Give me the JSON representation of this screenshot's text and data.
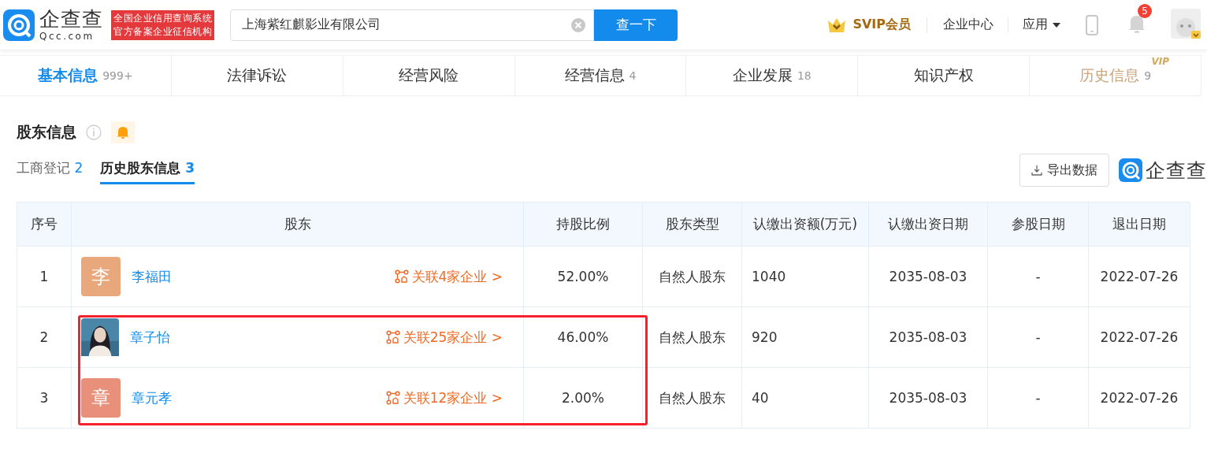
{
  "header": {
    "brand": "企查查",
    "domain": "Qcc.com",
    "badge_lines": [
      "全国企业信用查询系统",
      "官方备案企业征信机构"
    ],
    "search": {
      "value": "上海紫红麒影业有限公司"
    },
    "search_button": "查一下",
    "svip": "SVIP会员",
    "nav": [
      {
        "label": "企业中心",
        "kind": "link"
      },
      {
        "label": "应用",
        "kind": "dropdown"
      }
    ],
    "notification_count": "5"
  },
  "tabs": [
    {
      "label": "基本信息",
      "count": "999+",
      "selected": true,
      "kind": "normal"
    },
    {
      "label": "法律诉讼",
      "selected": false,
      "kind": "normal"
    },
    {
      "label": "经营风险",
      "selected": false,
      "kind": "normal"
    },
    {
      "label": "经营信息",
      "count": "4",
      "selected": false,
      "kind": "normal"
    },
    {
      "label": "企业发展",
      "count": "18",
      "selected": false,
      "kind": "normal"
    },
    {
      "label": "知识产权",
      "selected": false,
      "kind": "normal"
    },
    {
      "label": "历史信息",
      "count": "9",
      "selected": false,
      "kind": "vip",
      "badge": "VIP"
    }
  ],
  "section": {
    "title": "股东信息",
    "subtabs": [
      {
        "label": "工商登记",
        "count": "2",
        "selected": false
      },
      {
        "label": "历史股东信息",
        "count": "3",
        "selected": true
      }
    ],
    "export_button": "导出数据",
    "watermark_brand": "企查查"
  },
  "table": {
    "columns": [
      "序号",
      "股东",
      "持股比例",
      "股东类型",
      "认缴出资额(万元)",
      "认缴出资日期",
      "参股日期",
      "退出日期"
    ],
    "rows": [
      {
        "index": "1",
        "avatar": {
          "kind": "letter",
          "text": "李",
          "color": "#e8a87c"
        },
        "name": "李福田",
        "related": "关联4家企业 >",
        "ratio": "52.00%",
        "type": "自然人股东",
        "amount": "1040",
        "date": "2035-08-03",
        "join_date": "-",
        "exit_date": "2022-07-26",
        "highlighted": false
      },
      {
        "index": "2",
        "name": "章子怡",
        "related": "关联25家企业 >",
        "ratio": "46.00%",
        "type": "自然人股东",
        "amount": "920",
        "date": "2035-08-03",
        "join_date": "-",
        "exit_date": "2022-07-26",
        "highlighted": true
      },
      {
        "index": "3",
        "avatar": {
          "kind": "letter",
          "text": "章",
          "color": "#e8907a"
        },
        "name": "章元孝",
        "related": "关联12家企业 >",
        "ratio": "2.00%",
        "type": "自然人股东",
        "amount": "40",
        "date": "2035-08-03",
        "join_date": "-",
        "exit_date": "2022-07-26",
        "highlighted": true
      }
    ]
  }
}
